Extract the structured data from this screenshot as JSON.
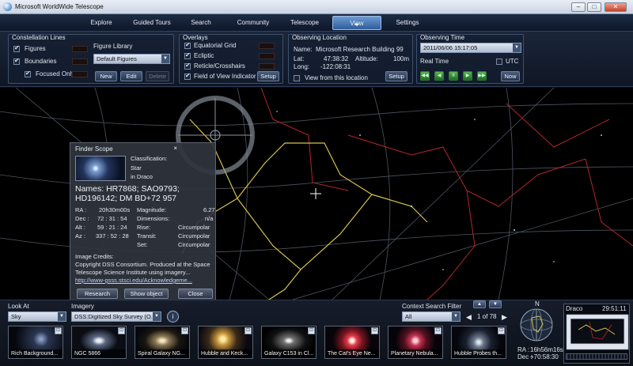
{
  "window": {
    "title": "Microsoft WorldWide Telescope",
    "min": "–",
    "max": "□",
    "close": "✕"
  },
  "menu": {
    "tabs": [
      {
        "label": "Explore"
      },
      {
        "label": "Guided Tours"
      },
      {
        "label": "Search"
      },
      {
        "label": "Community"
      },
      {
        "label": "Telescope"
      },
      {
        "label": "View"
      },
      {
        "label": "Settings"
      }
    ],
    "active": "View"
  },
  "constellation_lines": {
    "title": "Constellation Lines",
    "figures": "Figures",
    "boundaries": "Boundaries",
    "focused_only": "Focused Only",
    "figure_library_label": "Figure Library",
    "figure_library_value": "Default Figures",
    "new_label": "New",
    "edit_label": "Edit",
    "delete_label": "Delete"
  },
  "overlays": {
    "title": "Overlays",
    "equatorial_grid": "Equatorial Grid",
    "ecliptic": "Ecliptic",
    "reticle": "Reticle/Crosshairs",
    "fov": "Field of View Indicator",
    "setup_label": "Setup"
  },
  "observing_location": {
    "title": "Observing Location",
    "name_label": "Name:",
    "name_value": "Microsoft Research Building 99",
    "lat_label": "Lat:",
    "lat_value": "47:38:32",
    "alt_label": "Altitude:",
    "alt_value": "100m",
    "long_label": "Long:",
    "long_value": "-122:08:31",
    "view_from_label": "View from this location",
    "setup_label": "Setup"
  },
  "observing_time": {
    "title": "Observing Time",
    "datetime": "2011/06/06  15:17:05",
    "realtime_label": "Real Time",
    "utc_label": "UTC",
    "controls": [
      "◀◀",
      "◀",
      "II",
      "▶",
      "▶▶"
    ],
    "now_label": "Now"
  },
  "finder": {
    "title": "Finder Scope",
    "close": "×",
    "classification_label": "Classification:",
    "class_value": "Star",
    "constellation": "in Draco",
    "names": "Names:  HR7868; SAO9793; HD196142; DM BD+72  957",
    "ra_label": "RA :",
    "ra_value": "20h30m00s",
    "dec_label": "Dec :",
    "dec_value": "72 : 31 : 54",
    "alt_label": "Alt :",
    "alt_value": "59 : 21 : 24",
    "az_label": "Az :",
    "az_value": "337 : 52 : 28",
    "mag_label": "Magnitude:",
    "mag_value": "6.27",
    "dim_label": "Dimensions:",
    "dim_value": "n/a",
    "rise_label": "Rise:",
    "rise_value": "Circumpolar",
    "transit_label": "Transit:",
    "transit_value": "Circumpolar",
    "set_label": "Set:",
    "set_value": "Circumpolar",
    "credits_title": "Image Credits:",
    "credits_text": "Copyright DSS Consortium. Produced at the Space Telescope Science Institute using imagery...",
    "credits_link": "http://www-gsss.stsci.edu/Acknowledgeme...",
    "research_label": "Research",
    "show_object_label": "Show object",
    "close_label": "Close"
  },
  "bottom": {
    "look_at_label": "Look At",
    "look_at_value": "Sky",
    "imagery_label": "Imagery",
    "imagery_value": "DSS:Digitized Sky Survey (O...",
    "context_filter_label": "Context Search Filter",
    "context_filter_value": "All",
    "page_indicator": "1 of 78",
    "tiles": [
      {
        "caption": "Rich Background..."
      },
      {
        "caption": "NGC 5866"
      },
      {
        "caption": "Spiral Galaxy NG..."
      },
      {
        "caption": "Hubble and Keck..."
      },
      {
        "caption": "Galaxy C153 in Cl..."
      },
      {
        "caption": "The Cat's Eye Ne..."
      },
      {
        "caption": "Planetary Nebula..."
      },
      {
        "caption": "Hubble Probes th..."
      }
    ],
    "compass_n": "N",
    "ra_label": "RA :",
    "ra_value": "16h56m16s",
    "dec_label": "Dec :",
    "dec_value": "+70:58:30",
    "minimap_title": "Draco",
    "minimap_time": "29:51:11"
  },
  "colors": {
    "constellation_yellow": "#d6c24a",
    "boundary_red": "#b3262a",
    "grid_gray": "#4d5561"
  }
}
